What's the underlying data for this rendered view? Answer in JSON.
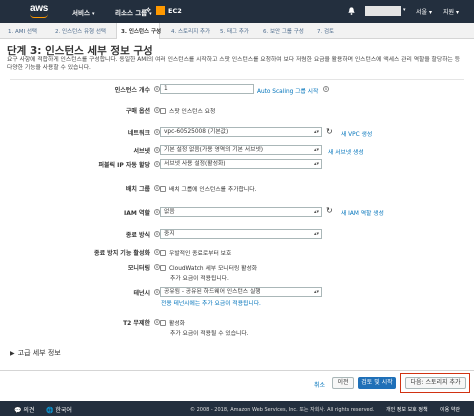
{
  "nav": {
    "brand": "aws",
    "services": "서비스",
    "resource_groups": "리소스 그룹",
    "ec2": "EC2",
    "region": "서울",
    "support": "지원"
  },
  "steps": [
    "1. AMI 선택",
    "2. 인스턴스 유형 선택",
    "3. 인스턴스 구성",
    "4. 스토리지 추가",
    "5. 태그 추가",
    "6. 보안 그룹 구성",
    "7. 검토"
  ],
  "page": {
    "title": "단계 3: 인스턴스 세부 정보 구성",
    "description": "요구 사항에 적합하게 인스턴스를 구성합니다. 동일한 AMI의 여러 인스턴스를 시작하고 스팟 인스턴스를 요청하여 보다 저렴한 요금을 활용하며 인스턴스에 액세스 관리 역할을 할당하는 등 다양한 기능을 사용할 수 있습니다."
  },
  "form": {
    "instance_count_label": "인스턴스 개수",
    "instance_count_value": "1",
    "asg_link": "Auto Scaling 그룹 시작",
    "purchase_label": "구매 옵션",
    "purchase_spot": "스팟 인스턴스 요청",
    "network_label": "네트워크",
    "network_value": "vpc-60525008 (기본값)",
    "new_vpc_link": "새 VPC 생성",
    "subnet_label": "서브넷",
    "subnet_value": "기본 설정 없음(가용 영역의 기본 서브넷)",
    "new_subnet_link": "새 서브넷 생성",
    "public_ip_label": "퍼블릭 IP 자동 할당",
    "public_ip_value": "서브넷 사용 설정(활성화)",
    "placement_label": "배치 그룹",
    "placement_check": "배치 그룹에 인스턴스를 추가합니다.",
    "iam_label": "IAM 역할",
    "iam_value": "없음",
    "new_iam_link": "새 IAM 역할 생성",
    "shutdown_label": "종료 방식",
    "shutdown_value": "중지",
    "termination_label": "종료 방지 기능 활성화",
    "termination_check": "우발적인 종료로부터 보호",
    "monitoring_label": "모니터링",
    "monitoring_check": "CloudWatch 세부 모니터링 활성화",
    "monitoring_note": "추가 요금이 적용됩니다.",
    "tenancy_label": "테넌시",
    "tenancy_value": "공유됨 - 공유된 하드웨어 인스턴스 실행",
    "tenancy_note": "전용 테넌시에는 추가 요금이 적용됩니다.",
    "t2_label": "T2 무제한",
    "t2_check": "활성화",
    "t2_note": "추가 요금이 적용될 수 있습니다."
  },
  "advanced": "고급 세부 정보",
  "buttons": {
    "cancel": "취소",
    "prev": "이전",
    "review": "검토 및 시작",
    "next": "다음: 스토리지 추가"
  },
  "footer": {
    "feedback": "의견",
    "language": "한국어",
    "copyright": "© 2008 - 2018, Amazon Web Services, Inc. 또는 자회사. All rights reserved.",
    "privacy": "개인 정보 보호 정책",
    "terms": "이용 약관"
  },
  "colors": {
    "nav_bg": "#232f3e",
    "accent": "#ff9900",
    "link": "#0073bb",
    "primary": "#1f70b8",
    "highlight": "#d13212"
  }
}
